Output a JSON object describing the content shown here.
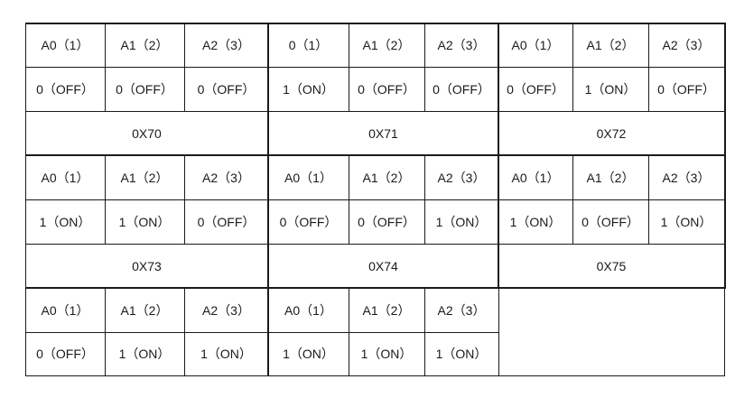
{
  "groups": [
    {
      "headers": [
        "A0（1）",
        "A1（2）",
        "A2（3）"
      ],
      "values": [
        "0（OFF）",
        "0（OFF）",
        "0（OFF）"
      ],
      "address": "0X70"
    },
    {
      "headers": [
        "0（1）",
        "A1（2）",
        "A2（3）"
      ],
      "values": [
        "1（ON）",
        "0（OFF）",
        "0（OFF）"
      ],
      "address": "0X71"
    },
    {
      "headers": [
        "A0（1）",
        "A1（2）",
        "A2（3）"
      ],
      "values": [
        "0（OFF）",
        "1（ON）",
        "0（OFF）"
      ],
      "address": "0X72"
    },
    {
      "headers": [
        "A0（1）",
        "A1（2）",
        "A2（3）"
      ],
      "values": [
        "1（ON）",
        "1（ON）",
        "0（OFF）"
      ],
      "address": "0X73"
    },
    {
      "headers": [
        "A0（1）",
        "A1（2）",
        "A2（3）"
      ],
      "values": [
        "0（OFF）",
        "0（OFF）",
        "1（ON）"
      ],
      "address": "0X74"
    },
    {
      "headers": [
        "A0（1）",
        "A1（2）",
        "A2（3）"
      ],
      "values": [
        "1（ON）",
        "0（OFF）",
        "1（ON）"
      ],
      "address": "0X75"
    },
    {
      "headers": [
        "A0（1）",
        "A1（2）",
        "A2（3）"
      ],
      "values": [
        "0（OFF）",
        "1（ON）",
        "1（ON）"
      ],
      "address": ""
    },
    {
      "headers": [
        "A0（1）",
        "A1（2）",
        "A2（3）"
      ],
      "values": [
        "1（ON）",
        "1（ON）",
        "1（ON）"
      ],
      "address": ""
    }
  ]
}
